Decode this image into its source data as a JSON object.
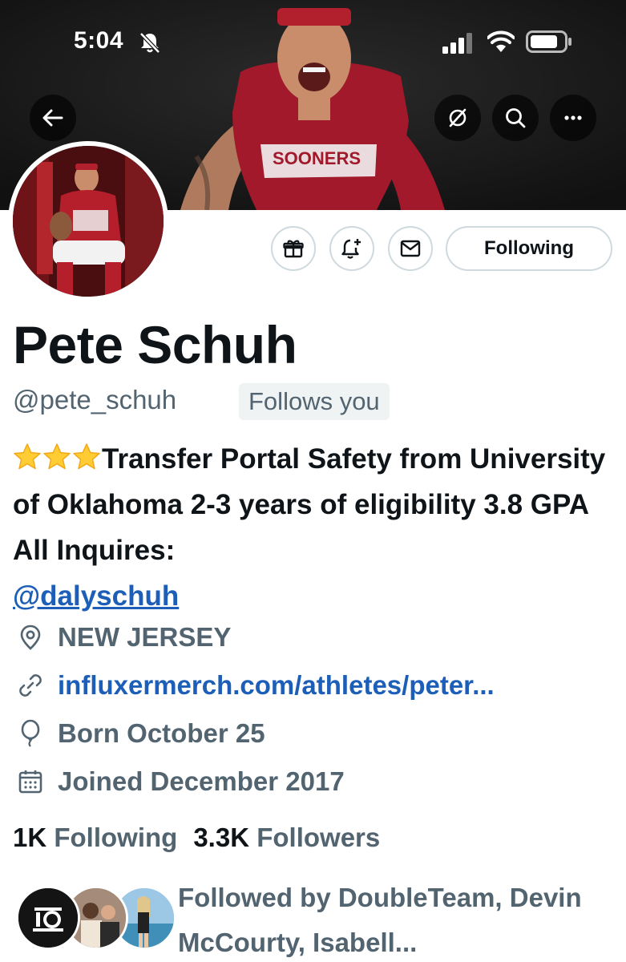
{
  "status_bar": {
    "time": "5:04"
  },
  "header": {
    "back_icon": "arrow-left-icon",
    "grok_icon": "grok-icon",
    "search_icon": "search-icon",
    "more_icon": "more-horizontal-icon",
    "banner_jersey_text": "SOONERS"
  },
  "actions": {
    "gift_icon": "gift-icon",
    "notify_icon": "bell-plus-icon",
    "message_icon": "mail-icon",
    "following_label": "Following"
  },
  "profile": {
    "display_name": "Pete Schuh",
    "handle": "@pete_schuh",
    "follows_you": "Follows you",
    "bio_text": "Transfer Portal Safety from University of Oklahoma 2-3 years of eligibility 3.8 GPA All Inquires:",
    "bio_stars": 3,
    "bio_mention": "@dalyschuh",
    "location": "NEW JERSEY",
    "website": "influxermerch.com/athletes/peter...",
    "born": "Born October 25",
    "joined": "Joined December 2017"
  },
  "stats": {
    "following_count": "1K",
    "following_label": "Following",
    "followers_count": "3.3K",
    "followers_label": "Followers"
  },
  "followed_by": {
    "text": "Followed by DoubleTeam, Devin McCourty, Isabell..."
  },
  "colors": {
    "text_primary": "#0f1419",
    "text_secondary": "#536471",
    "link": "#1d5fb8",
    "border": "#cfd9de",
    "jersey_red": "#a1192b"
  }
}
